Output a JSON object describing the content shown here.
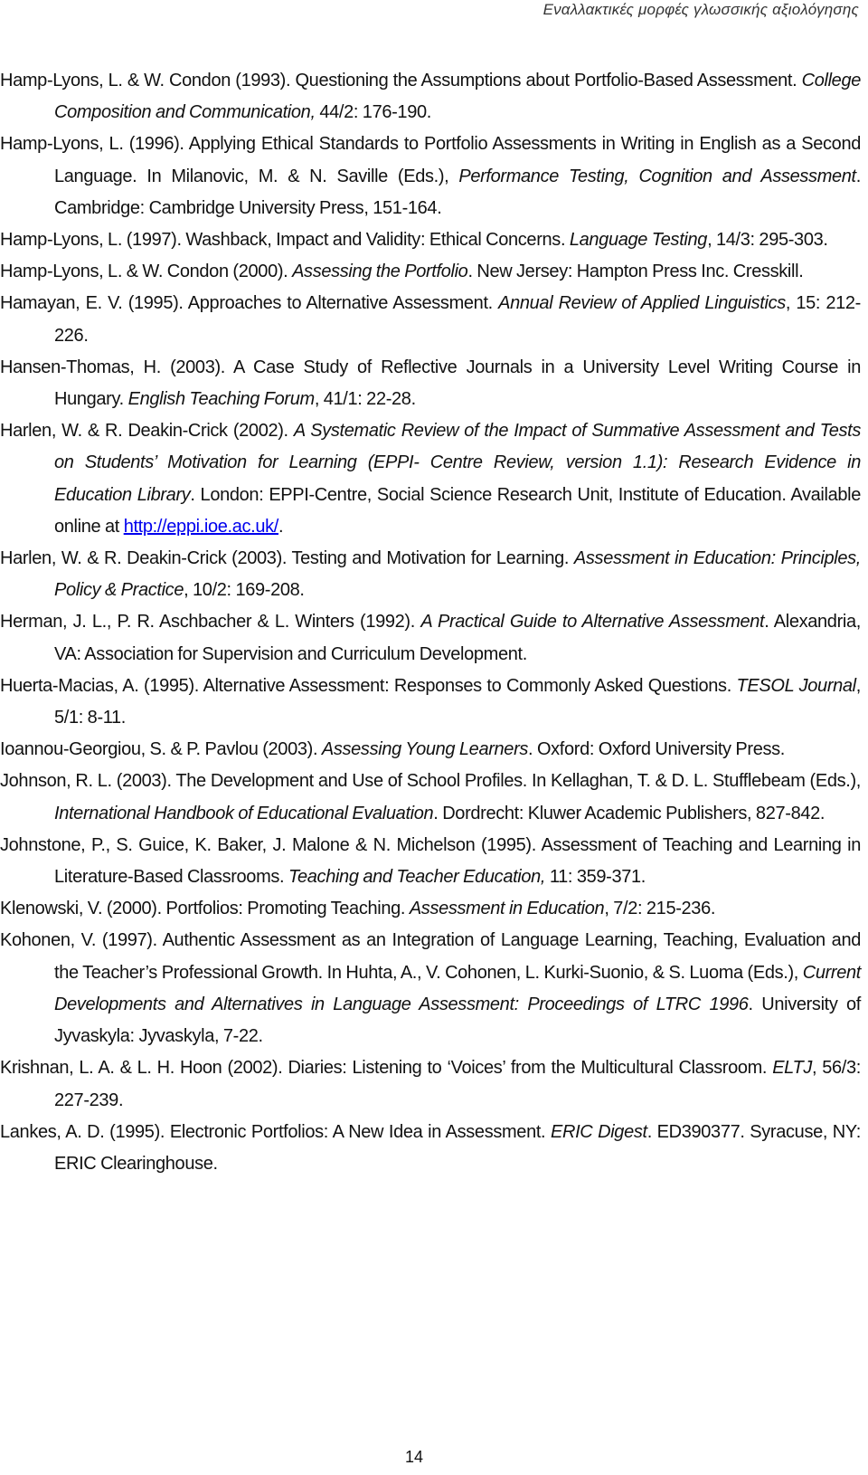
{
  "header": {
    "running_title": "Εναλλακτικές μορφές γλωσσικής αξιολόγησης"
  },
  "references": [
    {
      "parts": [
        {
          "t": "Hamp-Lyons, L. & W. Condon (1993). Questioning the Assumptions about Portfolio-Based Assessment. "
        },
        {
          "t": "College Composition and Communication,",
          "i": true
        },
        {
          "t": " 44/2: 176-190."
        }
      ]
    },
    {
      "parts": [
        {
          "t": "Hamp-Lyons, L. (1996). Applying Ethical Standards to Portfolio Assessments in Writing in English as a Second Language. In Milanovic, M. & N. Saville (Eds.), "
        },
        {
          "t": "Performance Testing, Cognition and Assessment",
          "i": true
        },
        {
          "t": ". Cambridge: Cambridge University Press, 151-164."
        }
      ]
    },
    {
      "parts": [
        {
          "t": "Hamp-Lyons, L. (1997). Washback, Impact and Validity: Ethical Concerns. "
        },
        {
          "t": "Language Testing",
          "i": true
        },
        {
          "t": ", 14/3: 295-303."
        }
      ]
    },
    {
      "parts": [
        {
          "t": "Hamp-Lyons, L. & W. Condon (2000). "
        },
        {
          "t": "Assessing the Portfolio",
          "i": true
        },
        {
          "t": ". New Jersey: Hampton Press Inc. Cresskill."
        }
      ]
    },
    {
      "parts": [
        {
          "t": "Hamayan, E. V. (1995). Approaches to Alternative Assessment. "
        },
        {
          "t": "Annual Review of Applied Linguistics",
          "i": true
        },
        {
          "t": ", 15: 212-226."
        }
      ]
    },
    {
      "parts": [
        {
          "t": "Hansen-Thomas, H. (2003). A Case Study of Reflective Journals in a University Level Writing Course in Hungary. "
        },
        {
          "t": "English Teaching Forum",
          "i": true
        },
        {
          "t": ", 41/1: 22-28."
        }
      ]
    },
    {
      "parts": [
        {
          "t": "Harlen, W. & R. Deakin-Crick (2002). "
        },
        {
          "t": "A Systematic Review of the Impact of Summative Assessment and Tests on Students’ Motivation for Learning (EPPI- Centre Review, version 1.1): Research Evidence in Education Library",
          "i": true
        },
        {
          "t": ". London: EPPI-Centre, Social Science Research Unit, Institute of Education. Available online at "
        },
        {
          "t": "http://eppi.ioe.ac.uk/",
          "link": true
        },
        {
          "t": "."
        }
      ]
    },
    {
      "parts": [
        {
          "t": "Harlen, W. & R. Deakin-Crick (2003). Testing and Motivation for Learning. "
        },
        {
          "t": "Assessment in Education: Principles, Policy & Practice",
          "i": true
        },
        {
          "t": ", 10/2: 169-208."
        }
      ]
    },
    {
      "parts": [
        {
          "t": "Herman, J. L., P. R. Aschbacher & L. Winters (1992). "
        },
        {
          "t": "A Practical Guide to Alternative Assessment",
          "i": true
        },
        {
          "t": ". Alexandria, VA: Association for Supervision and Curriculum Development."
        }
      ]
    },
    {
      "parts": [
        {
          "t": "Huerta-Macias, A. (1995). Alternative Assessment: Responses to Commonly Asked Questions. "
        },
        {
          "t": "TESOL Journal",
          "i": true
        },
        {
          "t": ", 5/1: 8-11."
        }
      ]
    },
    {
      "parts": [
        {
          "t": "Ioannou-Georgiou, S. & P. Pavlou (2003). "
        },
        {
          "t": "Assessing Young Learners",
          "i": true
        },
        {
          "t": ". Oxford: Oxford University Press."
        }
      ]
    },
    {
      "parts": [
        {
          "t": "Johnson, R. L. (2003). The Development and Use of School Profiles. In Kellaghan, T. & D. L. Stufflebeam (Eds.), "
        },
        {
          "t": "International Handbook of Educational Evaluation",
          "i": true
        },
        {
          "t": ". Dordrecht: Kluwer Academic Publishers, 827-842."
        }
      ]
    },
    {
      "parts": [
        {
          "t": "Johnstone, P., S. Guice, K. Baker, J. Malone & N. Michelson (1995). Assessment of Teaching and Learning in Literature-Based Classrooms. "
        },
        {
          "t": "Teaching and Teacher Education,",
          "i": true
        },
        {
          "t": " 11: 359-371."
        }
      ]
    },
    {
      "parts": [
        {
          "t": "Klenowski, V. (2000). Portfolios: Promoting Teaching. "
        },
        {
          "t": "Assessment in Education",
          "i": true
        },
        {
          "t": ", 7/2: 215-236."
        }
      ]
    },
    {
      "parts": [
        {
          "t": "Kohonen, V. (1997). Authentic Assessment as an Integration of Language Learning, Teaching, Evaluation and the Teacher’s Professional Growth. In Huhta, A., V. Cohonen, L. Kurki-Suonio, & S. Luoma (Eds.), "
        },
        {
          "t": "Current Developments and Alternatives in Language Assessment: Proceedings of LTRC 1996",
          "i": true
        },
        {
          "t": ". University of Jyvaskyla: Jyvaskyla, 7-22."
        }
      ]
    },
    {
      "parts": [
        {
          "t": "Krishnan, L. A. & L. H. Hoon (2002). Diaries: Listening to ‘Voices’ from the Multicultural Classroom. "
        },
        {
          "t": "ELTJ",
          "i": true
        },
        {
          "t": ", 56/3: 227-239."
        }
      ]
    },
    {
      "parts": [
        {
          "t": "Lankes, A. D. (1995). Electronic Portfolios: A New Idea in Assessment. "
        },
        {
          "t": "ERIC Digest",
          "i": true
        },
        {
          "t": ". ED390377. Syracuse, NY: ERIC Clearinghouse."
        }
      ]
    }
  ],
  "footer": {
    "page_number": "14"
  },
  "colors": {
    "text": "#111111",
    "link": "#0000ee"
  }
}
